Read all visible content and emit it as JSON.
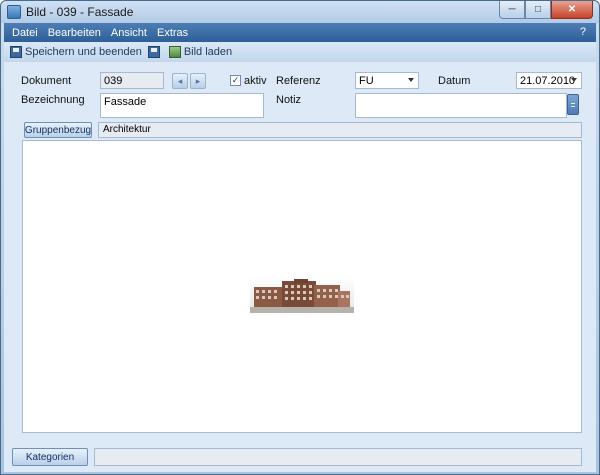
{
  "window": {
    "title": "Bild - 039 - Fassade",
    "minimize": "─",
    "maximize": "□",
    "close": "✕"
  },
  "menu": {
    "items": [
      "Datei",
      "Bearbeiten",
      "Ansicht",
      "Extras"
    ],
    "help": "?"
  },
  "toolbar": {
    "save_close_label": "Speichern und beenden",
    "load_image_label": "Bild laden"
  },
  "form": {
    "dokument_label": "Dokument",
    "dokument_value": "039",
    "aktiv_label": "aktiv",
    "aktiv_checked": "✓",
    "referenz_label": "Referenz",
    "referenz_value": "FU",
    "datum_label": "Datum",
    "datum_value": "21.07.2010",
    "bezeichnung_label": "Bezeichnung",
    "bezeichnung_value": "Fassade",
    "notiz_label": "Notiz",
    "notiz_value": "",
    "nav_prev": "◂",
    "nav_next": "▸"
  },
  "group": {
    "button_label": "Gruppenbezug",
    "value": "Architektur"
  },
  "bottom": {
    "kategorien_label": "Kategorien",
    "status_value": ""
  },
  "icons": {
    "app": "window-app-icon",
    "save": "floppy-disk-icon",
    "load": "image-load-icon"
  }
}
